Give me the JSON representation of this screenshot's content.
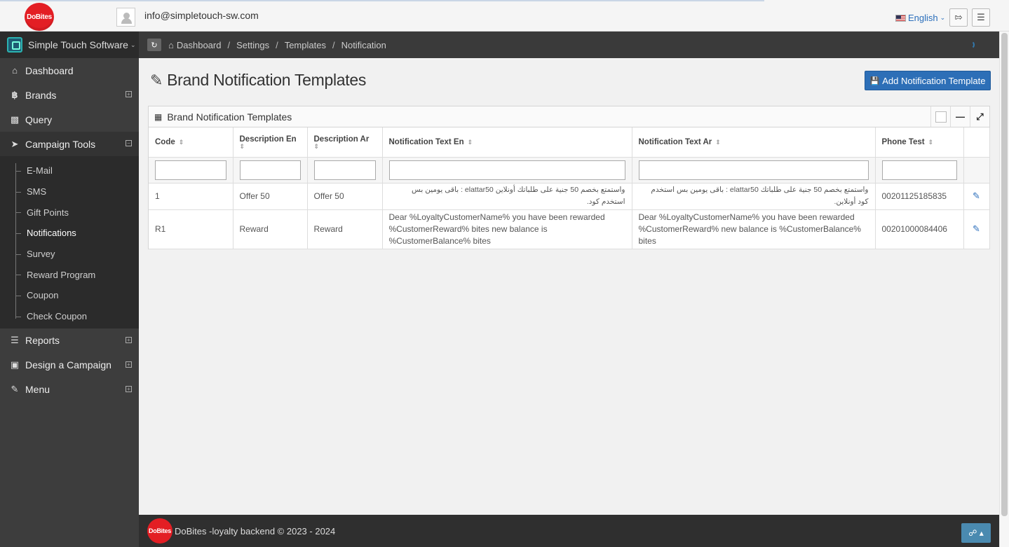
{
  "header": {
    "logo_text": "DoBites",
    "user_email": "info@simpletouch-sw.com",
    "language": "English",
    "logout_icon": "sign-out-icon",
    "menu_icon": "hamburger-icon"
  },
  "sidebar": {
    "brand_name": "Simple Touch Software",
    "items": [
      {
        "label": "Dashboard",
        "icon": "home-icon"
      },
      {
        "label": "Brands",
        "icon": "bitcoin-icon"
      },
      {
        "label": "Query",
        "icon": "puzzle-icon"
      },
      {
        "label": "Campaign Tools",
        "icon": "send-icon"
      },
      {
        "label": "Reports",
        "icon": "database-icon"
      },
      {
        "label": "Design a Campaign",
        "icon": "suitcase-icon"
      },
      {
        "label": "Menu",
        "icon": "edit-icon"
      }
    ],
    "campaign_subitems": [
      {
        "label": "E-Mail"
      },
      {
        "label": "SMS"
      },
      {
        "label": "Gift Points"
      },
      {
        "label": "Notifications"
      },
      {
        "label": "Survey"
      },
      {
        "label": "Reward Program"
      },
      {
        "label": "Coupon"
      },
      {
        "label": "Check Coupon"
      }
    ]
  },
  "breadcrumb": [
    "Dashboard",
    "Settings",
    "Templates",
    "Notification"
  ],
  "page": {
    "title": "Brand Notification Templates",
    "add_button": "Add Notification Template",
    "panel_title": "Brand Notification Templates"
  },
  "table": {
    "columns": [
      "Code",
      "Description En",
      "Description Ar",
      "Notification Text En",
      "Notification Text Ar",
      "Phone Test"
    ],
    "rows": [
      {
        "code": "1",
        "desc_en": "Offer 50",
        "desc_ar": "Offer 50",
        "text_en": "واستمتع بخصم 50 جنية على طلباتك أونلاين elattar50 : باقى يومين بس استخدم كود.",
        "text_ar": "واستمتع بخصم 50 جنية على طلباتك elattar50 : باقى يومين بس استخدم كود أونلاين.",
        "phone": "00201125185835"
      },
      {
        "code": "R1",
        "desc_en": "Reward",
        "desc_ar": "Reward",
        "text_en": "Dear %LoyaltyCustomerName% you have been rewarded %CustomerReward% bites new balance is %CustomerBalance% bites",
        "text_ar": "Dear %LoyaltyCustomerName% you have been rewarded %CustomerReward% new balance is %CustomerBalance% bites",
        "phone": "00201000084406"
      }
    ]
  },
  "footer": {
    "text": "DoBites -loyalty backend © 2023 - 2024"
  }
}
